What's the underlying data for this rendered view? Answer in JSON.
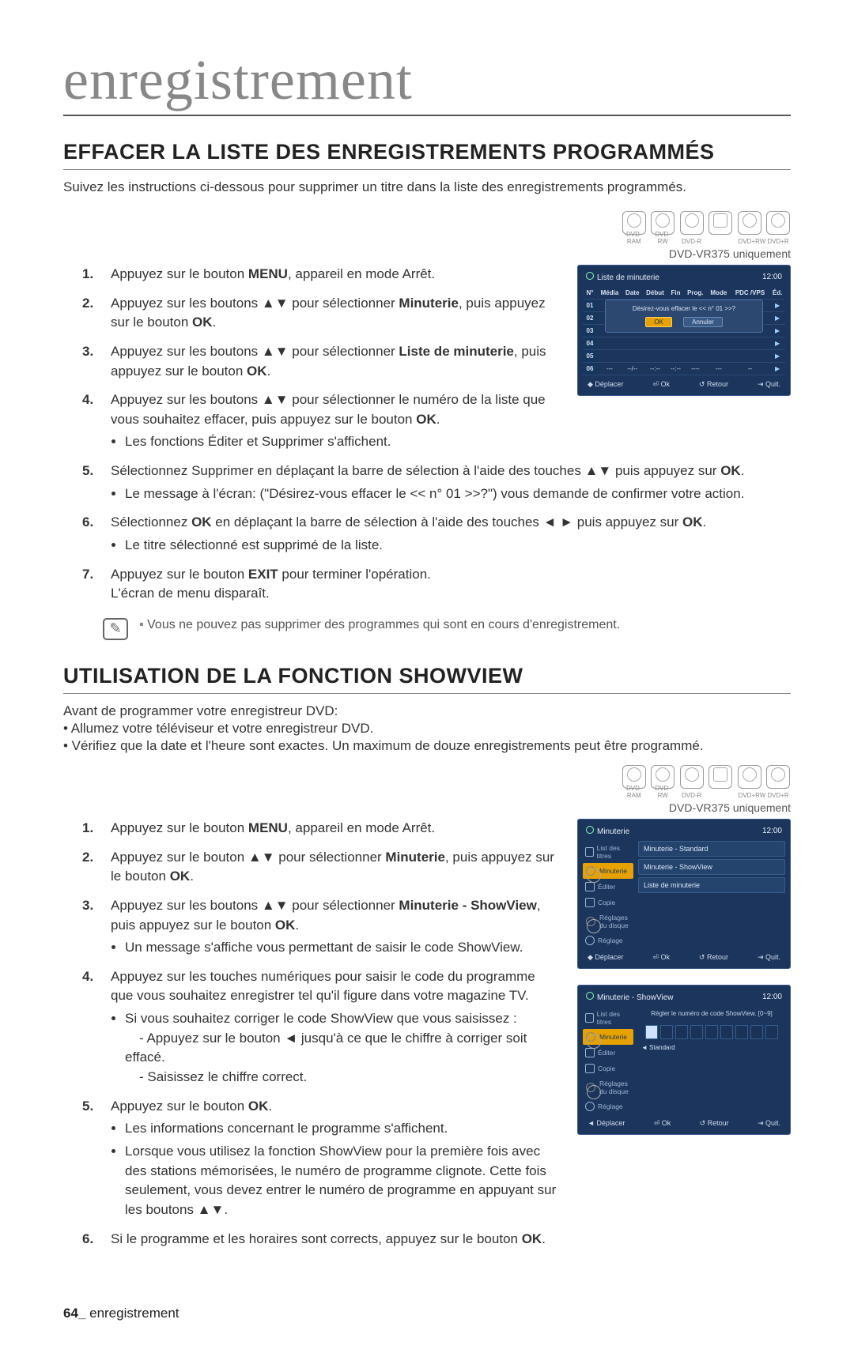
{
  "header": "enregistrement",
  "section1": {
    "title": "EFFACER LA LISTE DES ENREGISTREMENTS PROGRAMMÉS",
    "intro": "Suivez les instructions ci-dessous pour supprimer un titre dans la liste des enregistrements programmés.",
    "discs": [
      "DVD-RAM",
      "DVD-RW",
      "DVD-R",
      "",
      "DVD+RW",
      "DVD+R"
    ],
    "noteRight": "DVD-VR375 uniquement",
    "steps": {
      "s1a": "Appuyez sur le bouton ",
      "s1b": "MENU",
      "s1c": ", appareil en mode Arrêt.",
      "s2a": "Appuyez sur les boutons ▲▼ pour sélectionner ",
      "s2b": "Minuterie",
      "s2c": ", puis appuyez sur le bouton ",
      "s2d": "OK",
      "s3a": "Appuyez sur les boutons ▲▼ pour sélectionner ",
      "s3b": "Liste de minuterie",
      "s3c": ", puis appuyez sur le bouton ",
      "s3d": "OK",
      "s4a": "Appuyez sur les boutons ▲▼ pour sélectionner le numéro de la liste que vous souhaitez effacer, puis appuyez sur le bouton ",
      "s4b": "OK",
      "s4c": "Les fonctions Éditer et Supprimer s'affichent.",
      "s5a": "Sélectionnez Supprimer en déplaçant la barre de sélection à l'aide des touches ▲▼ puis appuyez sur ",
      "s5b": "OK",
      "s5c": "Le message à l'écran: (\"Désirez-vous effacer le << n° 01 >>?\") vous demande de confirmer votre action.",
      "s6a": "Sélectionnez ",
      "s6b": "OK",
      "s6c": " en déplaçant la barre de sélection à l'aide des touches ◄ ► puis appuyez sur ",
      "s6d": "OK",
      "s6e": "Le titre sélectionné est supprimé de la liste.",
      "s7a": "Appuyez sur le bouton ",
      "s7b": "EXIT",
      "s7c": " pour terminer l'opération.",
      "s7d": "L'écran de menu disparaît."
    },
    "tip": "Vous ne pouvez pas supprimer des programmes qui sont en cours d'enregistrement."
  },
  "section2": {
    "title": "UTILISATION DE LA FONCTION SHOWVIEW",
    "intro1": "Avant de programmer votre enregistreur DVD:",
    "intro2": "• Allumez votre téléviseur et votre enregistreur DVD.",
    "intro3": "• Vérifiez que la date et l'heure sont exactes. Un maximum de douze enregistrements peut être programmé.",
    "noteRight": "DVD-VR375 uniquement",
    "steps": {
      "s1a": "Appuyez sur le bouton ",
      "s1b": "MENU",
      "s1c": ", appareil en mode Arrêt.",
      "s2a": "Appuyez sur le bouton ▲▼ pour sélectionner ",
      "s2b": "Minuterie",
      "s2c": ", puis appuyez sur le bouton ",
      "s2d": "OK",
      "s3a": "Appuyez sur les boutons ▲▼ pour sélectionner ",
      "s3b": "Minuterie - ShowView",
      "s3c": ", puis appuyez sur le bouton ",
      "s3d": "OK",
      "s3e": "Un message s'affiche vous permettant de saisir le code ShowView.",
      "s4a": "Appuyez sur les touches numériques pour saisir le code du programme que vous souhaitez enregistrer tel qu'il figure dans votre magazine TV.",
      "s4b": "Si vous souhaitez corriger le code ShowView que vous saisissez :",
      "s4c": "- Appuyez sur le bouton ◄ jusqu'à ce que le chiffre à corriger soit effacé.",
      "s4d": "- Saisissez le chiffre correct.",
      "s5a": "Appuyez sur le bouton ",
      "s5b": "OK",
      "s5c": "Les informations concernant le programme s'affichent.",
      "s5d": "Lorsque vous utilisez la fonction ShowView pour la première fois avec des stations mémorisées, le numéro de programme clignote. Cette fois seulement, vous devez entrer le numéro de programme en appuyant sur les boutons ▲▼.",
      "s6a": "Si le programme et les horaires sont corrects, appuyez sur le bouton ",
      "s6b": "OK"
    }
  },
  "osd1": {
    "title": "Liste de minuterie",
    "time": "12:00",
    "cols": [
      "N°",
      "Média",
      "Date",
      "Début",
      "Fin",
      "Prog.",
      "Mode",
      "PDC /VPS",
      "Éd."
    ],
    "rows": [
      "01",
      "02",
      "03",
      "04",
      "05",
      "06"
    ],
    "lastRow": [
      "---",
      "--/--",
      "--:--",
      "--:--",
      "----",
      "---",
      "--"
    ],
    "dialog": "Désirez-vous effacer le << n° 01 >>?",
    "ok": "OK",
    "cancel": "Annuler",
    "foot": {
      "move": "◆ Déplacer",
      "ok": "⏎ Ok",
      "ret": "↺ Retour",
      "quit": "⇥ Quit."
    }
  },
  "osd2": {
    "title": "Minuterie",
    "time": "12:00",
    "side": [
      "List des titres",
      "Minuterie",
      "Éditer",
      "Copie",
      "Réglages du disque",
      "Réglage"
    ],
    "items": [
      "Minuterie - Standard",
      "Minuterie - ShowView",
      "Liste de minuterie"
    ],
    "foot": {
      "move": "◆ Déplacer",
      "ok": "⏎ Ok",
      "ret": "↺ Retour",
      "quit": "⇥ Quit."
    }
  },
  "osd3": {
    "title": "Minuterie - ShowView",
    "time": "12:00",
    "side": [
      "List des titres",
      "Minuterie",
      "Éditer",
      "Copie",
      "Réglages du disque",
      "Réglage"
    ],
    "hdr": "Régler le numéro de code ShowView. [0~9]",
    "std": "Standard",
    "foot": {
      "move": "◄ Déplacer",
      "ok": "⏎ Ok",
      "ret": "↺ Retour",
      "quit": "⇥ Quit."
    }
  },
  "footer": {
    "page": "64_",
    "section": "enregistrement"
  }
}
